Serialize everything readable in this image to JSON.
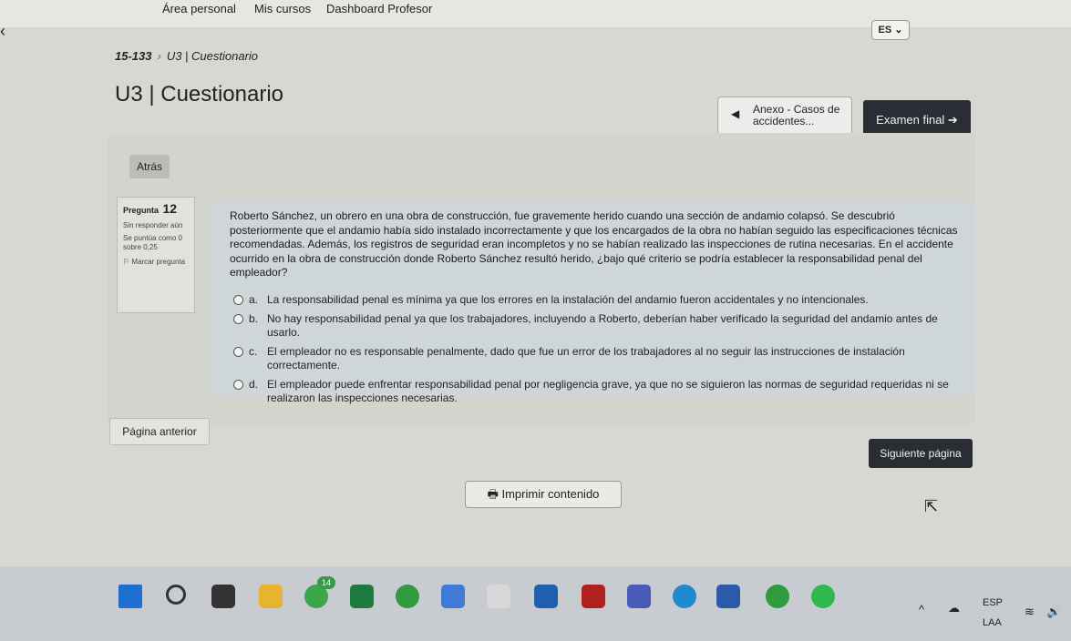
{
  "topnav": {
    "item1": "Área personal",
    "item2": "Mis cursos",
    "item3": "Dashboard Profesor",
    "lang": "ES ⌄"
  },
  "breadcrumb": {
    "code": "15-133",
    "page": "U3 | Cuestionario"
  },
  "page_title": "U3 | Cuestionario",
  "anexo_button": "Anexo - Casos de accidentes...",
  "final_button": "Examen final ➔",
  "back_button": "Atrás",
  "question_info": {
    "label": "Pregunta",
    "number": "12",
    "status": "Sin responder aún",
    "score": "Se puntúa como 0 sobre 0,25",
    "flag": "Marcar pregunta"
  },
  "question_text": "Roberto Sánchez, un obrero en una obra de construcción, fue gravemente herido cuando una sección de andamio colapsó. Se descubrió posteriormente que el andamio había sido instalado incorrectamente y que los encargados de la obra no habían seguido las especificaciones técnicas recomendadas. Además, los registros de seguridad eran incompletos y no se habían realizado las inspecciones de rutina necesarias. En el accidente ocurrido en la obra de construcción donde Roberto Sánchez resultó herido, ¿bajo qué criterio se podría establecer la responsabilidad penal del empleador?",
  "options": [
    {
      "letter": "a.",
      "text": "La responsabilidad penal es mínima ya que los errores en la instalación del andamio fueron accidentales y no intencionales."
    },
    {
      "letter": "b.",
      "text": "No hay responsabilidad penal ya que los trabajadores, incluyendo a Roberto, deberían haber verificado la seguridad del andamio antes de usarlo."
    },
    {
      "letter": "c.",
      "text": "El empleador no es responsable penalmente, dado que fue un error de los trabajadores al no seguir las instrucciones de instalación correctamente."
    },
    {
      "letter": "d.",
      "text": "El empleador puede enfrentar responsabilidad penal por negligencia grave, ya que no se siguieron las normas de seguridad requeridas ni se realizaron las inspecciones necesarias."
    }
  ],
  "prev_button": "Página anterior",
  "next_button": "Siguiente página",
  "print_button": "🖶 Imprimir contenido",
  "taskbar": {
    "badge": "14",
    "lang1": "ESP",
    "lang2": "LAA"
  }
}
